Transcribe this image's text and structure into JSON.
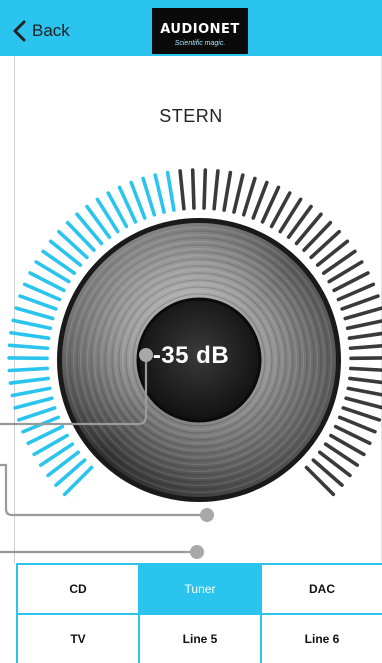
{
  "header": {
    "back_label": "Back",
    "logo_text": "AUDIONET",
    "logo_tagline": "Scientific magic.",
    "accent_color": "#2bc4ee"
  },
  "device": {
    "name": "STERN"
  },
  "volume": {
    "readout": "-35 dB",
    "level_fraction": 0.47
  },
  "sources": [
    {
      "label": "CD",
      "active": false
    },
    {
      "label": "Tuner",
      "active": true
    },
    {
      "label": "DAC",
      "active": false
    },
    {
      "label": "TV",
      "active": false
    },
    {
      "label": "Line 5",
      "active": false
    },
    {
      "label": "Line 6",
      "active": false
    }
  ]
}
